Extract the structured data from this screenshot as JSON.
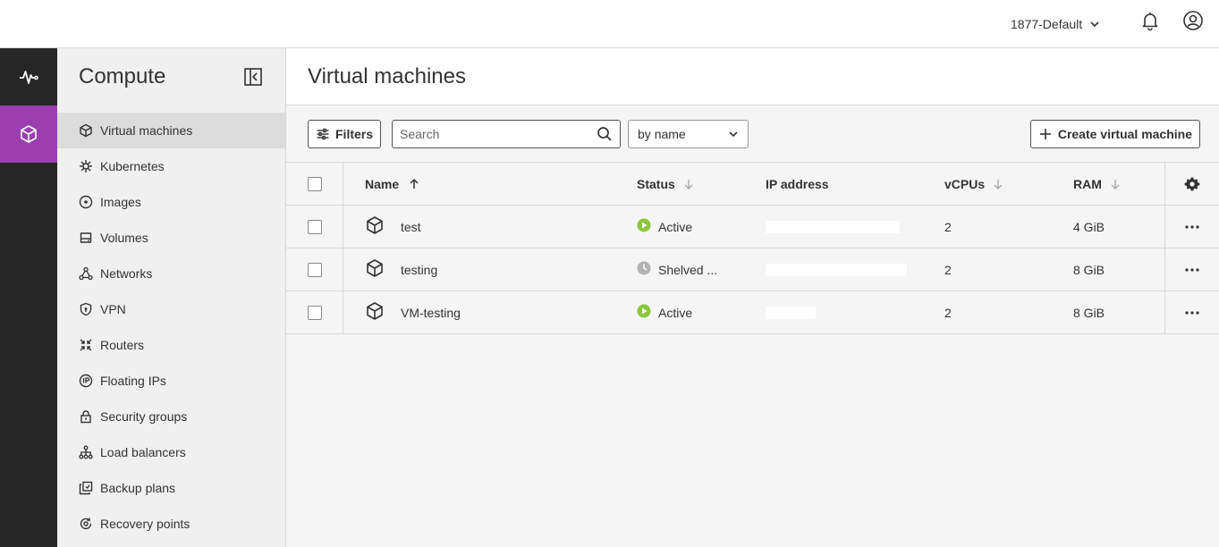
{
  "header": {
    "project": "1877-Default",
    "icons": [
      "bell-icon",
      "account-icon",
      "chevron-down-icon"
    ]
  },
  "rail": {
    "items": [
      {
        "icon": "activity-icon"
      },
      {
        "icon": "compute-cube-icon",
        "active": true
      }
    ],
    "active_color": "#9b3fb0"
  },
  "sidebar": {
    "title": "Compute",
    "items": [
      {
        "label": "Virtual machines",
        "icon": "cube-icon",
        "active": true
      },
      {
        "label": "Kubernetes",
        "icon": "kubernetes-icon"
      },
      {
        "label": "Images",
        "icon": "disc-icon"
      },
      {
        "label": "Volumes",
        "icon": "drive-icon"
      },
      {
        "label": "Networks",
        "icon": "network-icon"
      },
      {
        "label": "VPN",
        "icon": "shield-icon"
      },
      {
        "label": "Routers",
        "icon": "router-icon"
      },
      {
        "label": "Floating IPs",
        "icon": "floating-ip-icon"
      },
      {
        "label": "Security groups",
        "icon": "lock-icon"
      },
      {
        "label": "Load balancers",
        "icon": "load-balancer-icon"
      },
      {
        "label": "Backup plans",
        "icon": "backup-icon"
      },
      {
        "label": "Recovery points",
        "icon": "recovery-icon"
      }
    ]
  },
  "main": {
    "title": "Virtual machines",
    "toolbar": {
      "filters_label": "Filters",
      "search_placeholder": "Search",
      "sort_value": "by name",
      "create_label": "Create virtual machine"
    },
    "table": {
      "columns": {
        "name": "Name",
        "status": "Status",
        "ip": "IP address",
        "vcpus": "vCPUs",
        "ram": "RAM"
      },
      "rows": [
        {
          "name": "test",
          "status": "Active",
          "status_kind": "active",
          "vcpus": "2",
          "ram": "4 GiB"
        },
        {
          "name": "testing",
          "status": "Shelved ...",
          "status_kind": "shelved",
          "vcpus": "2",
          "ram": "8 GiB"
        },
        {
          "name": "VM-testing",
          "status": "Active",
          "status_kind": "active",
          "vcpus": "2",
          "ram": "8 GiB"
        }
      ]
    },
    "colors": {
      "active_status": "#8cc63f",
      "shelved_status": "#b3b3b3"
    }
  }
}
